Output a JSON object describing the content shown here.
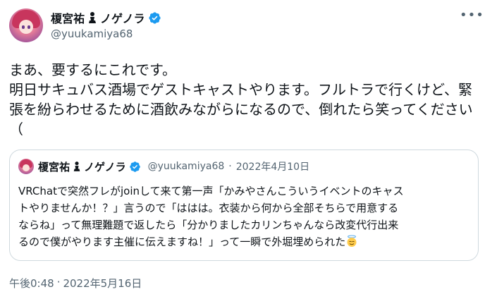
{
  "author": {
    "display_name": "榎宮祐",
    "display_name_suffix": "ノゲノラ",
    "pawn_icon": "chess-pawn-icon",
    "handle": "@yuukamiya68",
    "verified": true
  },
  "menu": {
    "more_label": "•••"
  },
  "tweet": {
    "lines": [
      "まあ、要するにこれです。",
      "明日サキュバス酒場でゲストキャストやります。フルトラで行くけど、緊",
      "張を紛らわせるために酒飲みながらになるので、倒れたら笑ってください",
      "（"
    ]
  },
  "quoted_tweet": {
    "display_name": "榎宮祐",
    "display_name_suffix": "ノゲノラ",
    "handle": "@yuukamiya68",
    "separator": "·",
    "date": "2022年4月10日",
    "lines": [
      "VRChatで突然フレがjoinして来て第一声「かみやさんこういうイベントのキャス",
      "トやりませんか！？」言うので「ははは。衣装から何から全部そちらで用意する",
      "ならね」って無理難題で返したら「分かりましたカリンちゃんなら改変代行出来",
      "るので僕がやります主催に伝えますね！」って一瞬で外堀埋められた"
    ],
    "emoji": "smiling-face-with-halo-icon"
  },
  "footer": {
    "time": "午後0:48",
    "separator": "·",
    "date": "2022年5月16日"
  },
  "colors": {
    "text": "#0f1419",
    "secondary": "#536471",
    "verified": "#1d9bf0",
    "border": "#cfd9de"
  }
}
